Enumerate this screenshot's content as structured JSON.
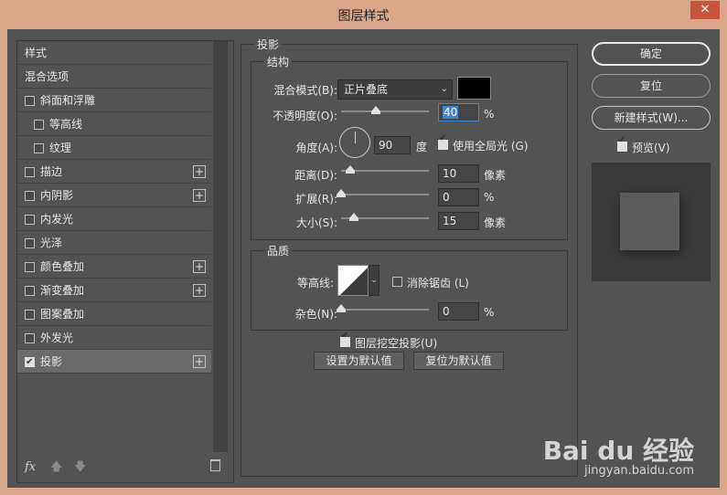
{
  "window": {
    "title": "图层样式",
    "close_glyph": "✕"
  },
  "styles": {
    "items": [
      {
        "label": "样式",
        "checkbox": false,
        "checked": false,
        "plus": false,
        "sub": false,
        "selected": false
      },
      {
        "label": "混合选项",
        "checkbox": false,
        "checked": false,
        "plus": false,
        "sub": false,
        "selected": false
      },
      {
        "label": "斜面和浮雕",
        "checkbox": true,
        "checked": false,
        "plus": false,
        "sub": false,
        "selected": false
      },
      {
        "label": "等高线",
        "checkbox": true,
        "checked": false,
        "plus": false,
        "sub": true,
        "selected": false
      },
      {
        "label": "纹理",
        "checkbox": true,
        "checked": false,
        "plus": false,
        "sub": true,
        "selected": false
      },
      {
        "label": "描边",
        "checkbox": true,
        "checked": false,
        "plus": true,
        "sub": false,
        "selected": false
      },
      {
        "label": "内阴影",
        "checkbox": true,
        "checked": false,
        "plus": true,
        "sub": false,
        "selected": false
      },
      {
        "label": "内发光",
        "checkbox": true,
        "checked": false,
        "plus": false,
        "sub": false,
        "selected": false
      },
      {
        "label": "光泽",
        "checkbox": true,
        "checked": false,
        "plus": false,
        "sub": false,
        "selected": false
      },
      {
        "label": "颜色叠加",
        "checkbox": true,
        "checked": false,
        "plus": true,
        "sub": false,
        "selected": false
      },
      {
        "label": "渐变叠加",
        "checkbox": true,
        "checked": false,
        "plus": true,
        "sub": false,
        "selected": false
      },
      {
        "label": "图案叠加",
        "checkbox": true,
        "checked": false,
        "plus": false,
        "sub": false,
        "selected": false
      },
      {
        "label": "外发光",
        "checkbox": true,
        "checked": false,
        "plus": false,
        "sub": false,
        "selected": false
      },
      {
        "label": "投影",
        "checkbox": true,
        "checked": true,
        "plus": true,
        "sub": false,
        "selected": true
      }
    ],
    "footer": {
      "fx": "fx",
      "up": "🡅",
      "down": "🡇"
    }
  },
  "drop_shadow": {
    "title": "投影",
    "structure": {
      "title": "结构",
      "blend_mode_label": "混合模式(B):",
      "blend_mode_value": "正片叠底",
      "opacity_label": "不透明度(O):",
      "opacity_value": "40",
      "opacity_unit": "%",
      "angle_label": "角度(A):",
      "angle_value": "90",
      "angle_unit": "度",
      "global_light_label": "使用全局光 (G)",
      "global_light_checked": true,
      "distance_label": "距离(D):",
      "distance_value": "10",
      "distance_unit": "像素",
      "spread_label": "扩展(R):",
      "spread_value": "0",
      "spread_unit": "%",
      "size_label": "大小(S):",
      "size_value": "15",
      "size_unit": "像素"
    },
    "quality": {
      "title": "品质",
      "contour_label": "等高线:",
      "antialias_label": "消除锯齿 (L)",
      "antialias_checked": false,
      "noise_label": "杂色(N):",
      "noise_value": "0",
      "noise_unit": "%"
    },
    "knockout_label": "图层挖空投影(U)",
    "knockout_checked": true,
    "make_default_label": "设置为默认值",
    "reset_default_label": "复位为默认值"
  },
  "actions": {
    "ok_label": "确定",
    "reset_label": "复位",
    "new_style_label": "新建样式(W)...",
    "preview_label": "预览(V)",
    "preview_checked": true
  },
  "watermark": {
    "logo": "Bai du 经验",
    "url": "jingyan.baidu.com"
  },
  "colors": {
    "shadow_color": "#000000",
    "panel_bg": "#535353",
    "title_bar": "#d9a68a",
    "close_button": "#c7563c",
    "accent": "#3f86d0"
  },
  "slider_levels": {
    "opacity": 0.4,
    "distance": 0.1,
    "spread": 0.0,
    "size": 0.15,
    "noise": 0.0
  }
}
